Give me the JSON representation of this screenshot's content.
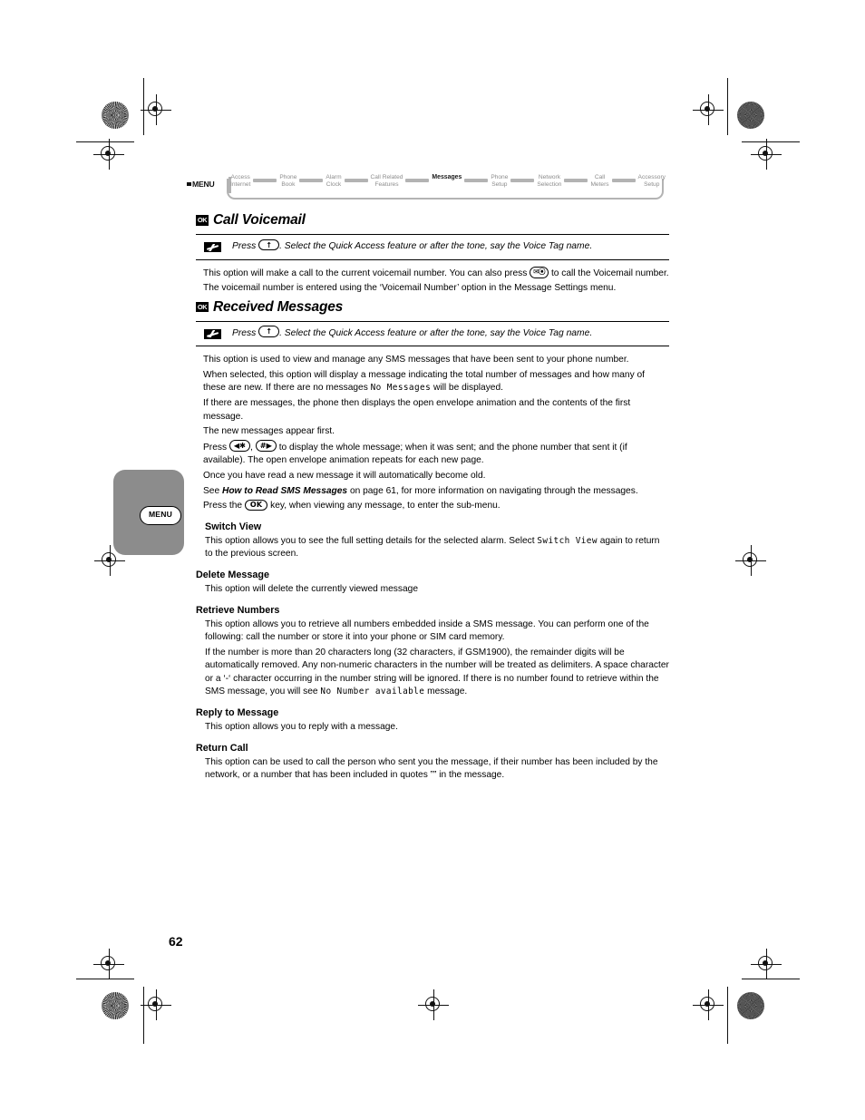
{
  "document": {
    "page_number": "62"
  },
  "menu_map": {
    "menu_label": "MENU",
    "crumbs": [
      {
        "line1": "Access",
        "line2": "Internet",
        "active": false
      },
      {
        "line1": "Phone",
        "line2": "Book",
        "active": false
      },
      {
        "line1": "Alarm",
        "line2": "Clock",
        "active": false
      },
      {
        "line1": "Call Related",
        "line2": "Features",
        "active": false
      },
      {
        "line1": "Messages",
        "line2": "",
        "active": true
      },
      {
        "line1": "Phone",
        "line2": "Setup",
        "active": false
      },
      {
        "line1": "Network",
        "line2": "Selection",
        "active": false
      },
      {
        "line1": "Call",
        "line2": "Meters",
        "active": false
      },
      {
        "line1": "Accessory",
        "line2": "Setup",
        "active": false
      }
    ]
  },
  "menu_tab_graphic": {
    "key_label": "MENU"
  },
  "sections": [
    {
      "ok_badge": "OK",
      "title": "Call Voicemail",
      "note": {
        "icon": "voice-tag-icon",
        "text_before_key": "Press ",
        "key": "↑",
        "text_after_key": ". Select the Quick Access feature or after the tone, say the Voice Tag name."
      },
      "paragraphs": [
        {
          "part1": "This option will make a call to the current voicemail number. You can also press ",
          "key": "✉⦿",
          "part2": " to call the Voicemail number."
        },
        {
          "part1": "The voicemail number is entered using the ‘Voicemail Number’ option in the Message Settings menu."
        }
      ]
    },
    {
      "ok_badge": "OK",
      "title": "Received Messages",
      "note": {
        "icon": "voice-tag-icon",
        "text_before_key": "Press ",
        "key": "↑",
        "text_after_key": ". Select the Quick Access feature or after the tone, say the Voice Tag name."
      },
      "paragraphs": [
        {
          "part1": "This option is used to view and manage any SMS messages that have been sent to your phone number."
        },
        {
          "part1": "When selected, this option will display a message indicating the total number of messages and how many of these are new. If there are no messages ",
          "lcd": "No Messages",
          "part2": " will be displayed."
        },
        {
          "part1": "If there are messages, the phone then displays the open envelope animation and the contents of the first message."
        },
        {
          "part1": "The new messages appear first."
        },
        {
          "part1": "Press ",
          "key1": "◀✱",
          "mid": ", ",
          "key2": "#▶",
          "part2": " to display the whole message; when it was sent; and the phone number that sent it (if available). The open envelope animation repeats for each new page."
        },
        {
          "part1": "Once you have read a new message it will automatically become old."
        },
        {
          "part1": "See ",
          "bold_italic": "How to Read SMS Messages",
          "part2": " on page 61,  for more information on navigating through the messages."
        },
        {
          "part1": "Press the ",
          "key": "OK",
          "part2": " key, when viewing any message, to enter the sub-menu."
        }
      ],
      "subsections": [
        {
          "heading": "Switch View",
          "indent_heading": true,
          "paragraphs": [
            {
              "part1": "This option allows you to see the full setting details for the selected alarm. Select ",
              "lcd": "Switch View",
              "part2": " again to return to the previous screen."
            }
          ]
        },
        {
          "heading": "Delete Message",
          "indent_heading": false,
          "paragraphs": [
            {
              "part1": "This option will delete the currently viewed message"
            }
          ]
        },
        {
          "heading": "Retrieve Numbers",
          "indent_heading": false,
          "paragraphs": [
            {
              "part1": "This option allows you to retrieve all numbers embedded inside a SMS message. You can perform one of the following: call the number or store it into your phone or SIM card memory."
            },
            {
              "part1": "If the number is more than 20 characters long (32 characters, if GSM1900), the remainder digits will be automatically removed. Any non-numeric characters in the number will be treated as delimiters. A space character or a ‘-‘ character occurring in the number string will be ignored. If there is no number found to retrieve within the SMS message, you will see ",
              "lcd": "No Number available",
              "part2": " message."
            }
          ]
        },
        {
          "heading": "Reply to Message",
          "indent_heading": false,
          "paragraphs": [
            {
              "part1": "This option allows you to reply with a message."
            }
          ]
        },
        {
          "heading": "Return Call",
          "indent_heading": false,
          "paragraphs": [
            {
              "part1": "This option can be used to call the person who sent you the message, if their number has been included by the network, or a number that has been included in quotes ”” in the message."
            }
          ]
        }
      ]
    }
  ]
}
